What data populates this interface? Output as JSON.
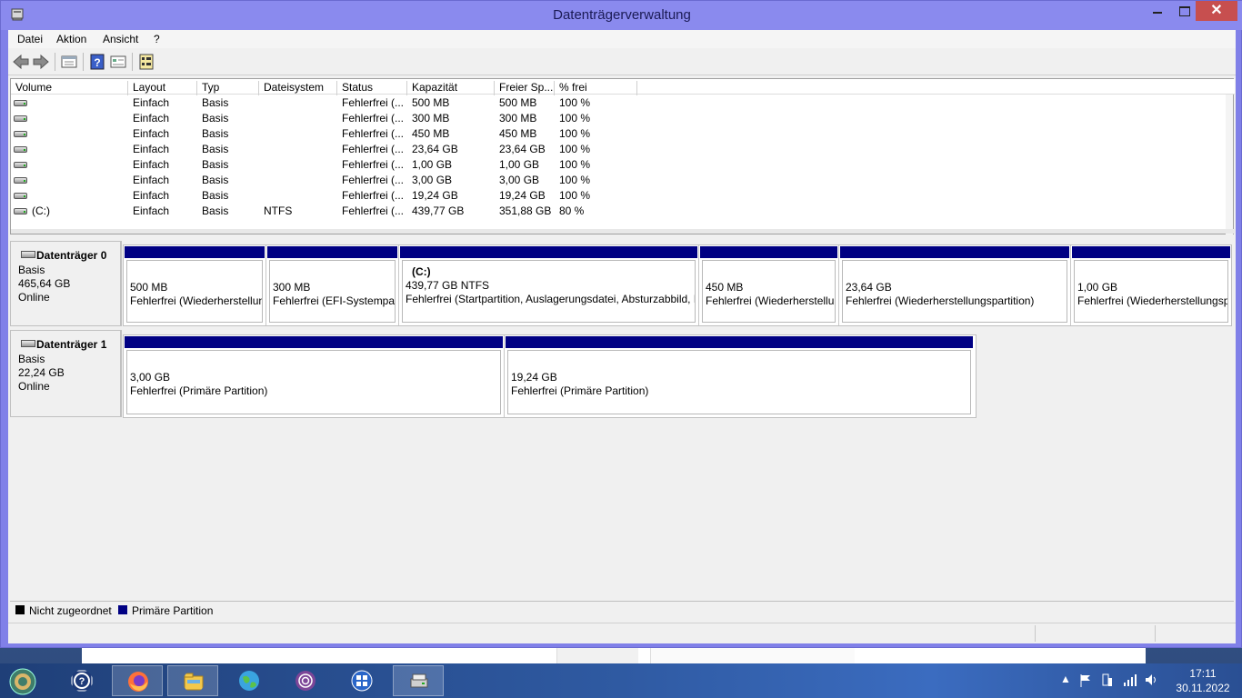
{
  "window": {
    "title": "Datenträgerverwaltung"
  },
  "menu": [
    "Datei",
    "Aktion",
    "Ansicht",
    "?"
  ],
  "columns": [
    "Volume",
    "Layout",
    "Typ",
    "Dateisystem",
    "Status",
    "Kapazität",
    "Freier Sp...",
    "% frei"
  ],
  "volumes": [
    {
      "volume": "",
      "layout": "Einfach",
      "typ": "Basis",
      "fs": "",
      "status": "Fehlerfrei (...",
      "cap": "500 MB",
      "free": "500 MB",
      "pct": "100 %"
    },
    {
      "volume": "",
      "layout": "Einfach",
      "typ": "Basis",
      "fs": "",
      "status": "Fehlerfrei (...",
      "cap": "300 MB",
      "free": "300 MB",
      "pct": "100 %"
    },
    {
      "volume": "",
      "layout": "Einfach",
      "typ": "Basis",
      "fs": "",
      "status": "Fehlerfrei (...",
      "cap": "450 MB",
      "free": "450 MB",
      "pct": "100 %"
    },
    {
      "volume": "",
      "layout": "Einfach",
      "typ": "Basis",
      "fs": "",
      "status": "Fehlerfrei (...",
      "cap": "23,64 GB",
      "free": "23,64 GB",
      "pct": "100 %"
    },
    {
      "volume": "",
      "layout": "Einfach",
      "typ": "Basis",
      "fs": "",
      "status": "Fehlerfrei (...",
      "cap": "1,00 GB",
      "free": "1,00 GB",
      "pct": "100 %"
    },
    {
      "volume": "",
      "layout": "Einfach",
      "typ": "Basis",
      "fs": "",
      "status": "Fehlerfrei (...",
      "cap": "3,00 GB",
      "free": "3,00 GB",
      "pct": "100 %"
    },
    {
      "volume": "",
      "layout": "Einfach",
      "typ": "Basis",
      "fs": "",
      "status": "Fehlerfrei (...",
      "cap": "19,24 GB",
      "free": "19,24 GB",
      "pct": "100 %"
    },
    {
      "volume": "(C:)",
      "layout": "Einfach",
      "typ": "Basis",
      "fs": "NTFS",
      "status": "Fehlerfrei (...",
      "cap": "439,77 GB",
      "free": "351,88 GB",
      "pct": "80 %"
    }
  ],
  "disk0": {
    "name": "Datenträger 0",
    "type": "Basis",
    "size": "465,64 GB",
    "state": "Online",
    "partitions": [
      {
        "title": "",
        "size": "500 MB",
        "status": "Fehlerfrei (Wiederherstellungspartition)"
      },
      {
        "title": "",
        "size": "300 MB",
        "status": "Fehlerfrei (EFI-Systempartition)"
      },
      {
        "title": "(C:)",
        "size": "439,77 GB NTFS",
        "status": "Fehlerfrei (Startpartition, Auslagerungsdatei, Absturzabbild, Primäre Partition)"
      },
      {
        "title": "",
        "size": "450 MB",
        "status": "Fehlerfrei (Wiederherstellungspartition)"
      },
      {
        "title": "",
        "size": "23,64 GB",
        "status": "Fehlerfrei (Wiederherstellungspartition)"
      },
      {
        "title": "",
        "size": "1,00 GB",
        "status": "Fehlerfrei (Wiederherstellungspartition)"
      }
    ]
  },
  "disk1": {
    "name": "Datenträger 1",
    "type": "Basis",
    "size": "22,24 GB",
    "state": "Online",
    "partitions": [
      {
        "size": "3,00 GB",
        "status": "Fehlerfrei (Primäre Partition)"
      },
      {
        "size": "19,24 GB",
        "status": "Fehlerfrei (Primäre Partition)"
      }
    ]
  },
  "legend": [
    {
      "label": "Nicht zugeordnet",
      "color": "#000000"
    },
    {
      "label": "Primäre Partition",
      "color": "#000083"
    }
  ],
  "taskbar": {
    "time": "17:11",
    "date": "30.11.2022",
    "icons": [
      "start-orb-icon",
      "help-icon",
      "firefox-icon",
      "file-explorer-icon",
      "network-globe-icon",
      "tor-browser-icon",
      "control-panel-icon",
      "disk-management-icon"
    ]
  }
}
